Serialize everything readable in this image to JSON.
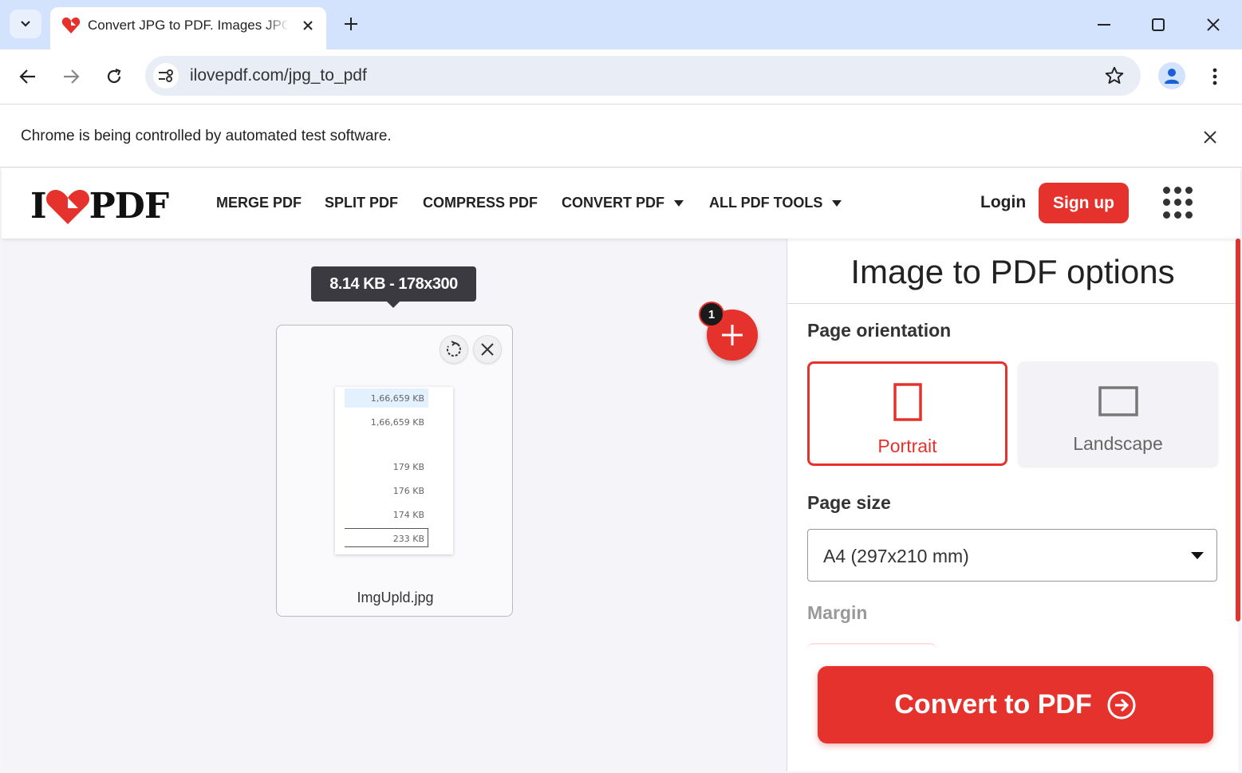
{
  "browser": {
    "tab_title": "Convert JPG to PDF. Images JPG to PDF",
    "url": "ilovepdf.com/jpg_to_pdf",
    "infobar_text": "Chrome is being controlled by automated test software."
  },
  "header": {
    "logo_left": "I",
    "logo_right": "PDF",
    "nav": [
      "MERGE PDF",
      "SPLIT PDF",
      "COMPRESS PDF",
      "CONVERT PDF",
      "ALL PDF TOOLS"
    ],
    "login": "Login",
    "signup": "Sign up"
  },
  "workspace": {
    "tooltip": "8.14 KB - 178x300",
    "file_count": "1",
    "file_name": "ImgUpld.jpg",
    "thumb_rows": [
      "1,66,659 KB",
      "1,66,659 KB",
      "179 KB",
      "176 KB",
      "174 KB",
      "233 KB"
    ]
  },
  "sidebar": {
    "title": "Image to PDF options",
    "orientation_label": "Page orientation",
    "portrait": "Portrait",
    "landscape": "Landscape",
    "page_size_label": "Page size",
    "page_size_value": "A4 (297x210 mm)",
    "margin_label": "Margin",
    "convert_button": "Convert to PDF"
  },
  "colors": {
    "brand": "#e5322d",
    "tab_strip": "#d3e3fd"
  }
}
